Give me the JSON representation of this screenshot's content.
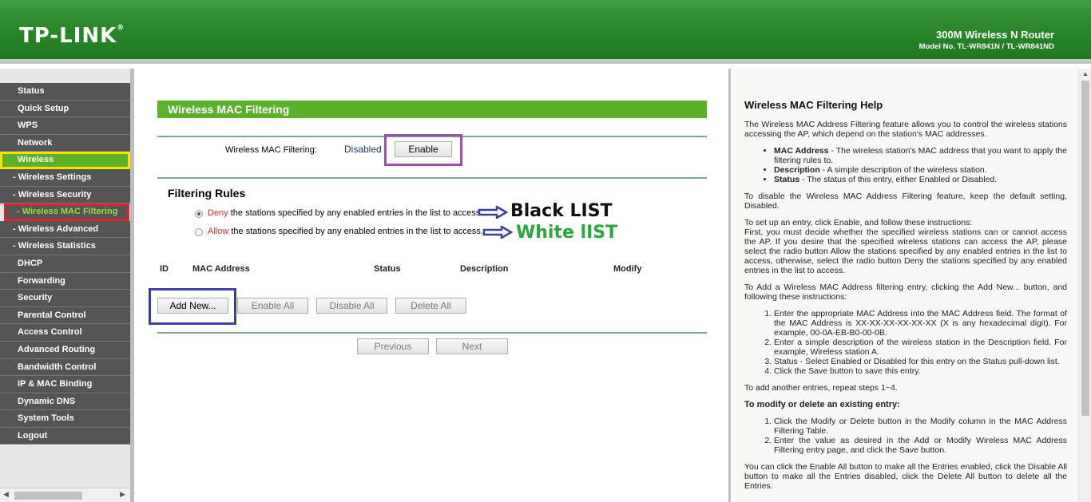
{
  "header": {
    "logo": "TP-LINK",
    "logo_mark": "®",
    "product": "300M Wireless N Router",
    "model": "Model No. TL-WR841N / TL-WR841ND"
  },
  "menu": [
    {
      "label": "Status",
      "sub": false,
      "state": ""
    },
    {
      "label": "Quick Setup",
      "sub": false,
      "state": ""
    },
    {
      "label": "WPS",
      "sub": false,
      "state": ""
    },
    {
      "label": "Network",
      "sub": false,
      "state": ""
    },
    {
      "label": "Wireless",
      "sub": false,
      "state": "active"
    },
    {
      "label": "- Wireless Settings",
      "sub": true,
      "state": ""
    },
    {
      "label": "- Wireless Security",
      "sub": true,
      "state": ""
    },
    {
      "label": "- Wireless MAC Filtering",
      "sub": true,
      "state": "current"
    },
    {
      "label": "- Wireless Advanced",
      "sub": true,
      "state": ""
    },
    {
      "label": "- Wireless Statistics",
      "sub": true,
      "state": ""
    },
    {
      "label": "DHCP",
      "sub": false,
      "state": ""
    },
    {
      "label": "Forwarding",
      "sub": false,
      "state": ""
    },
    {
      "label": "Security",
      "sub": false,
      "state": ""
    },
    {
      "label": "Parental Control",
      "sub": false,
      "state": ""
    },
    {
      "label": "Access Control",
      "sub": false,
      "state": ""
    },
    {
      "label": "Advanced Routing",
      "sub": false,
      "state": ""
    },
    {
      "label": "Bandwidth Control",
      "sub": false,
      "state": ""
    },
    {
      "label": "IP & MAC Binding",
      "sub": false,
      "state": ""
    },
    {
      "label": "Dynamic DNS",
      "sub": false,
      "state": ""
    },
    {
      "label": "System Tools",
      "sub": false,
      "state": ""
    },
    {
      "label": "Logout",
      "sub": false,
      "state": ""
    }
  ],
  "main": {
    "title": "Wireless MAC Filtering",
    "filter_label": "Wireless MAC Filtering:",
    "filter_status": "Disabled",
    "enable_button": "Enable",
    "rules_heading": "Filtering Rules",
    "deny_word": "Deny",
    "deny_rest": " the stations specified by any enabled entries in the list to access.",
    "allow_word": "Allow",
    "allow_rest": " the stations specified by any enabled entries in the list to access.",
    "deny_selected": true,
    "annot_black": "Black LIST",
    "annot_white": "White lIST",
    "columns": [
      "ID",
      "MAC Address",
      "Status",
      "Description",
      "Modify"
    ],
    "add_new": "Add New...",
    "enable_all": "Enable All",
    "disable_all": "Disable All",
    "delete_all": "Delete All",
    "previous": "Previous",
    "next": "Next"
  },
  "colors": {
    "brand_green": "#5bb22a",
    "annot_purple": "#9c4fa6",
    "annot_blue": "#3c3fa8",
    "annot_black": "#111111",
    "annot_white": "#27a83a"
  },
  "help": {
    "title": "Wireless MAC Filtering Help",
    "intro": "The Wireless MAC Address Filtering feature allows you to control the wireless stations accessing the AP, which depend on the station's MAC addresses.",
    "bullets": [
      {
        "b": "MAC Address",
        "t": " - The wireless station's MAC address that you want to apply the filtering rules to."
      },
      {
        "b": "Description",
        "t": " - A simple description of the wireless station."
      },
      {
        "b": "Status",
        "t": " - The status of this entry, either Enabled or Disabled."
      }
    ],
    "disable_text": "To disable the Wireless MAC Address Filtering feature, keep the default setting, Disabled.",
    "setup_text": "To set up an entry, click Enable, and follow these instructions:",
    "setup_text2": "First, you must decide whether the specified wireless stations can or cannot access the AP. If you desire that the specified wireless stations can access the AP, please select the radio button Allow the stations specified by any enabled entries in the list to access, otherwise, select the radio button Deny the stations specified by any enabled entries in the list to access.",
    "add_text": "To Add a Wireless MAC Address filtering entry, clicking the Add New... button, and following these instructions:",
    "steps": [
      "Enter the appropriate MAC Address into the MAC Address field. The format of the MAC Address is XX-XX-XX-XX-XX-XX (X is any hexadecimal digit). For example, 00-0A-EB-B0-00-0B.",
      "Enter a simple description of the wireless station in the Description field. For example, Wireless station A.",
      "Status - Select Enabled or Disabled for this entry on the Status pull-down list.",
      "Click the Save button to save this entry."
    ],
    "repeat_text": "To add another entries, repeat steps 1~4.",
    "modify_heading": "To modify or delete an existing entry:",
    "modify_steps": [
      "Click the Modify or Delete button in the Modify column in the MAC Address Filtering Table.",
      "Enter the value as desired in the Add or Modify Wireless MAC Address Filtering entry page, and click the Save button."
    ],
    "enable_all_text": "You can click the Enable All button to make all the Entries enabled, click the Disable All button to make all the Entries disabled, click the Delete All button to delete all the Entries."
  }
}
